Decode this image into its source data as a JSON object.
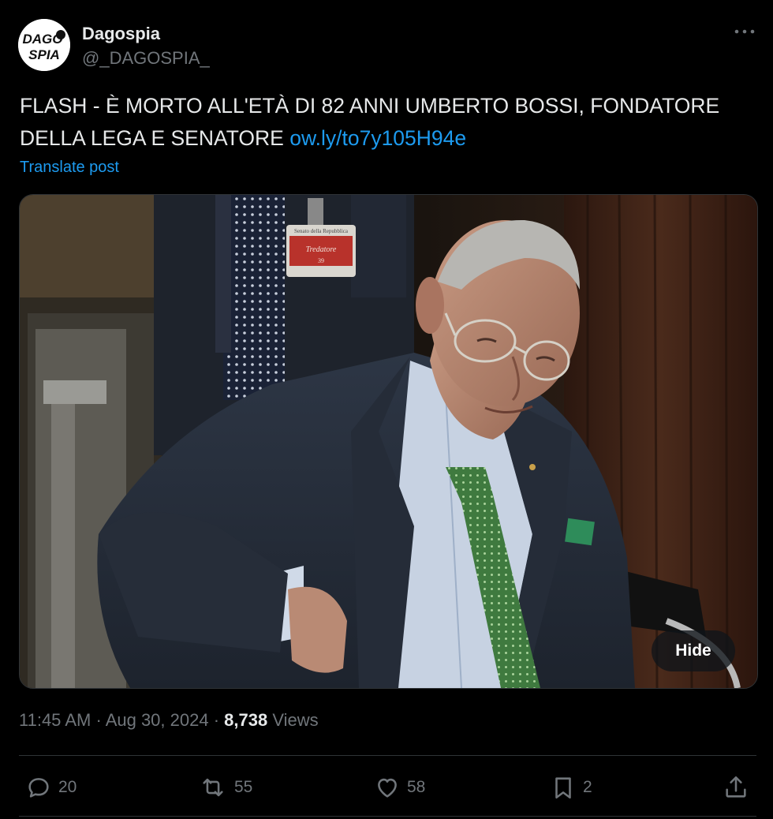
{
  "author": {
    "avatar_text_top": "DAGO",
    "avatar_text_bottom": "SPIA",
    "name": "Dagospia",
    "handle": "@_DAGOSPIA_"
  },
  "post": {
    "text_line1": "FLASH - È MORTO ALL'ETÀ DI 82 ANNI UMBERTO BOSSI, FONDATORE",
    "text_line2": "DELLA LEGA E SENATORE ",
    "link": "ow.ly/to7y105H94e",
    "translate_label": "Translate post"
  },
  "media": {
    "description_icon": "photo",
    "badge_top": "Senato della Repubblica",
    "badge_name": "Tredatore",
    "badge_number": "39",
    "hide_label": "Hide"
  },
  "meta": {
    "time": "11:45 AM",
    "separator": "·",
    "date": "Aug 30, 2024",
    "views_count": "8,738",
    "views_label": "Views"
  },
  "actions": {
    "replies": "20",
    "reposts": "55",
    "likes": "58",
    "bookmarks": "2"
  },
  "colors": {
    "background": "#000000",
    "text": "#e7e9ea",
    "secondary": "#71767b",
    "link": "#1d9bf0",
    "divider": "#2f3336"
  },
  "icons": [
    "more-icon",
    "reply-icon",
    "repost-icon",
    "like-icon",
    "bookmark-icon",
    "share-icon"
  ]
}
